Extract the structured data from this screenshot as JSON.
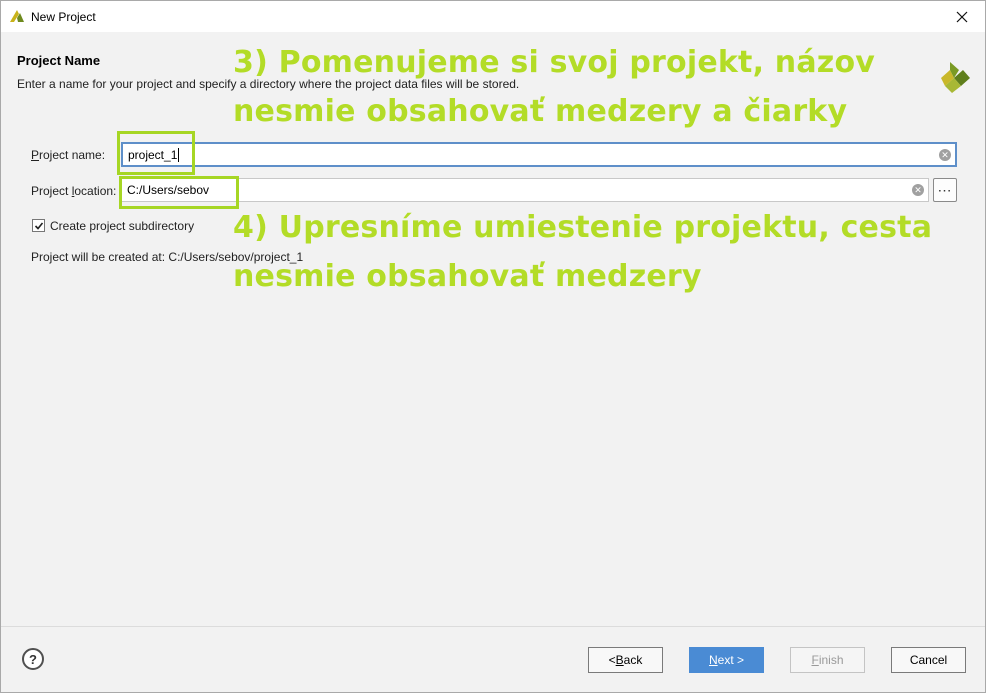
{
  "window": {
    "title": "New Project",
    "close_icon": "close-icon"
  },
  "header": {
    "title": "Project Name",
    "description": "Enter a name for your project and specify a directory where the project data files will be stored."
  },
  "form": {
    "name_label_mnemonic": "P",
    "name_label_rest": "roject name:",
    "name_value": "project_1",
    "location_label_start": "Project ",
    "location_label_mnemonic": "l",
    "location_label_rest": "ocation:",
    "location_value": "C:/Users/sebov",
    "browse_label": "⋯",
    "subdirectory_label": "Create project subdirectory",
    "subdirectory_checked": true,
    "created_at_text": "Project will be created at: C:/Users/sebov/project_1"
  },
  "annotations": {
    "step3_line1": "3) Pomenujeme si svoj projekt, názov",
    "step3_line2": "nesmie obsahovať medzery a čiarky",
    "step4_line1": "4) Upresníme umiestenie projektu, cesta",
    "step4_line2": "nesmie obsahovať medzery",
    "highlight_color": "#a6d624"
  },
  "footer": {
    "help_label": "?",
    "back_mnemonic": "B",
    "back_prefix": "< ",
    "back_rest": "ack",
    "next_mnemonic": "N",
    "next_rest": "ext >",
    "finish_mnemonic": "F",
    "finish_rest": "inish",
    "cancel_label": "Cancel"
  },
  "colors": {
    "primary_button": "#4a8bd4",
    "focus_border": "#5e8fc9",
    "annotation_text": "#b3dc27"
  }
}
